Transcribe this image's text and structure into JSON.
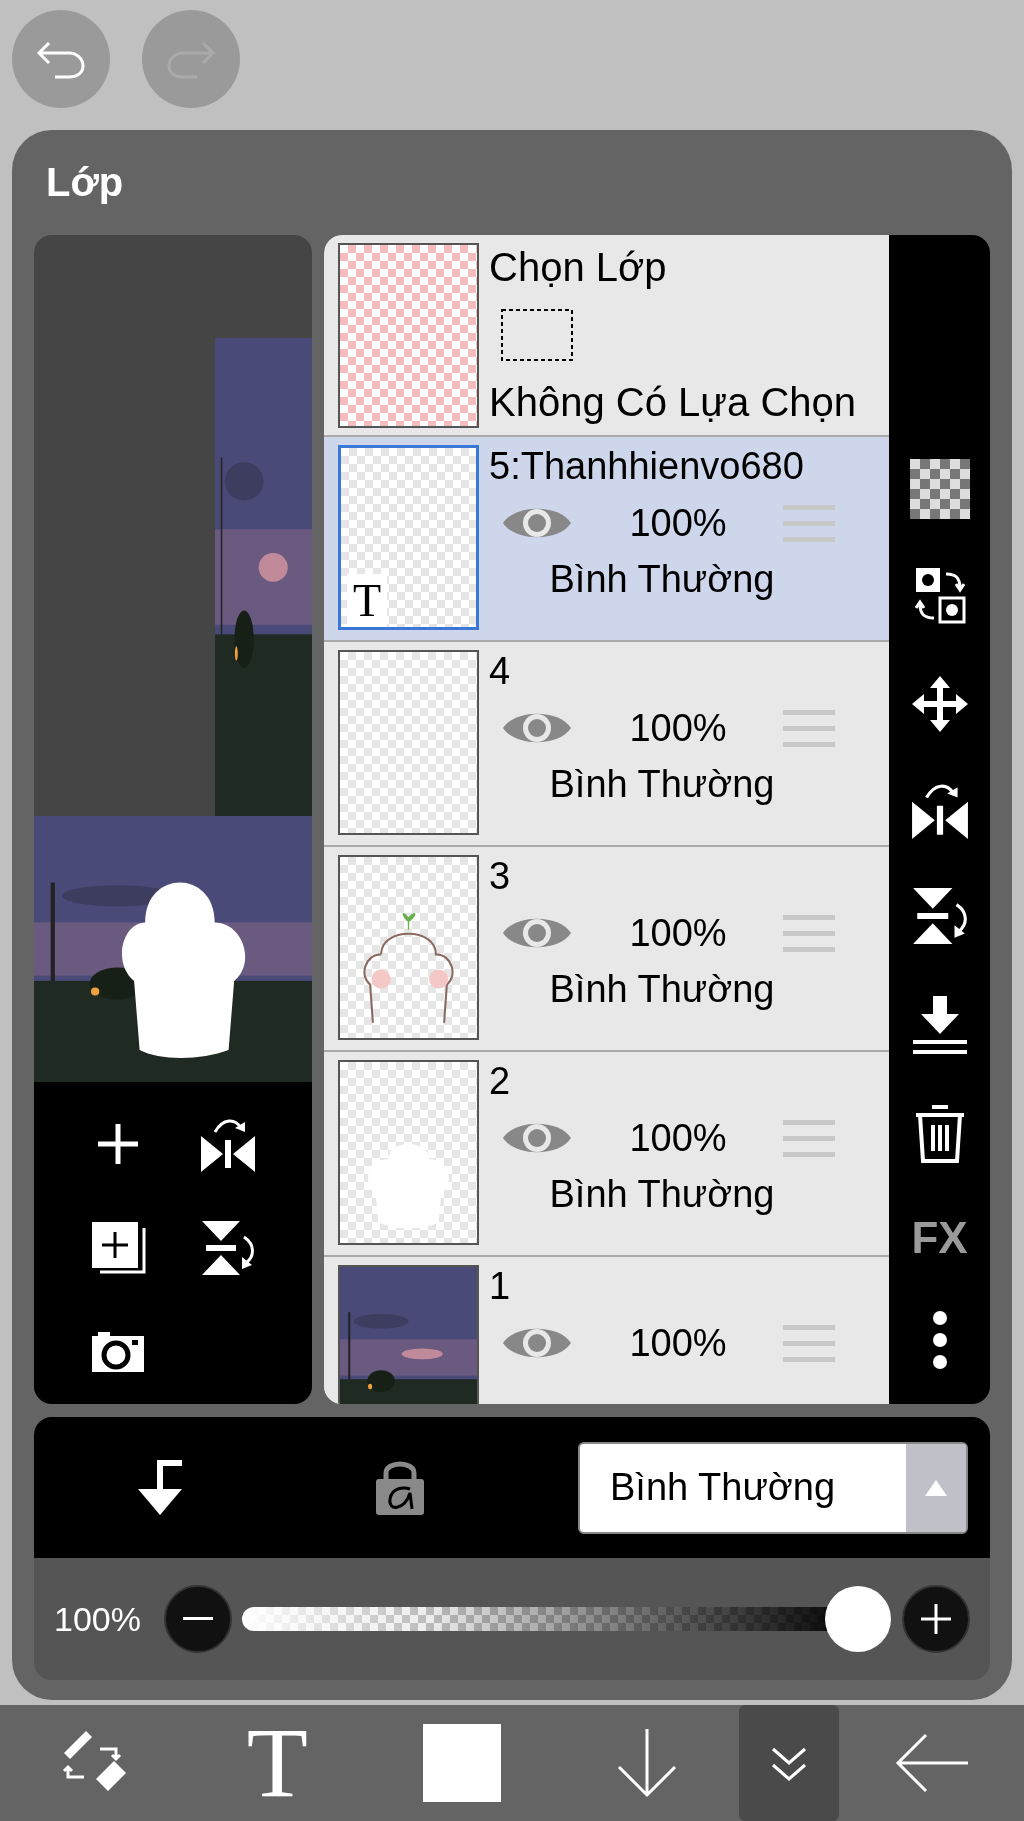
{
  "panel": {
    "title": "Lớp"
  },
  "selection_layer": {
    "title": "Chọn Lớp",
    "status": "Không Có Lựa Chọn"
  },
  "layers": [
    {
      "name": "5:Thanhhienvo680",
      "opacity": "100%",
      "blend": "Bình Thường",
      "selected": true,
      "visible": true,
      "kind": "text",
      "badge": "T"
    },
    {
      "name": "4",
      "opacity": "100%",
      "blend": "Bình Thường",
      "selected": false,
      "visible": true,
      "kind": "empty"
    },
    {
      "name": "3",
      "opacity": "100%",
      "blend": "Bình Thường",
      "selected": false,
      "visible": true,
      "kind": "lineart"
    },
    {
      "name": "2",
      "opacity": "100%",
      "blend": "Bình Thường",
      "selected": false,
      "visible": true,
      "kind": "fill"
    },
    {
      "name": "1",
      "opacity": "100%",
      "selected": false,
      "visible": true
    }
  ],
  "side_tools": {
    "fx_label": "FX"
  },
  "blend_mode": {
    "value": "Bình Thường"
  },
  "opacity_slider": {
    "reading": "100%",
    "level": 1
  },
  "toolbar": {
    "text_tool": "T",
    "items": [
      {
        "kind": "brush-swap",
        "selected": false
      },
      {
        "kind": "text",
        "selected": false
      },
      {
        "kind": "color",
        "selected": false
      },
      {
        "kind": "down",
        "selected": false
      },
      {
        "kind": "collapse",
        "selected": true
      },
      {
        "kind": "back",
        "selected": false
      }
    ]
  }
}
